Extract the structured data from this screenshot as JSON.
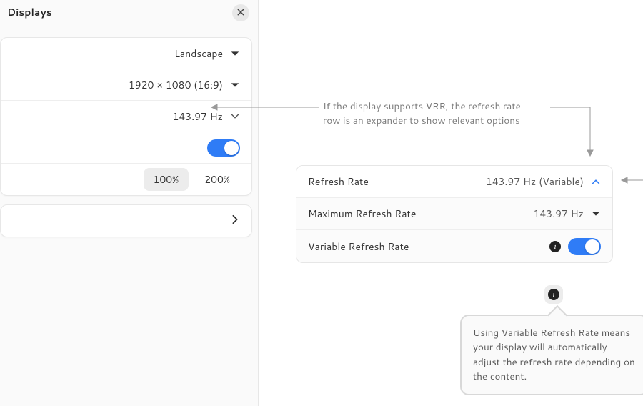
{
  "header": {
    "title": "Displays"
  },
  "leftRows": {
    "orientation": "Landscape",
    "resolution": "1920 × 1080 (16:9)",
    "refresh": "143.97 Hz",
    "scale100": "100%",
    "scale200": "200%"
  },
  "annotation": {
    "line1": "If the display supports VRR, the refresh rate",
    "line2": "row is an expander to show relevant options"
  },
  "rightCard": {
    "refreshLabel": "Refresh Rate",
    "refreshValue": "143.97 Hz (Variable)",
    "maxLabel": "Maximum Refresh Rate",
    "maxValue": "143.97 Hz",
    "vrrLabel": "Variable Refresh Rate"
  },
  "tooltip": "Using Variable Refresh Rate means your display will automatically adjust the refresh rate depending on the content."
}
